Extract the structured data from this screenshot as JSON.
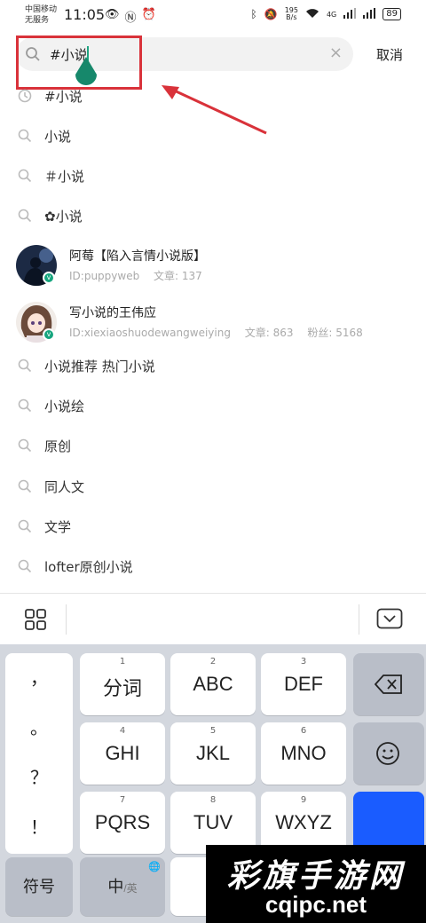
{
  "status_bar": {
    "carrier_line1": "中国移动",
    "carrier_line2": "无服务",
    "time": "11:05",
    "net_speed_value": "195",
    "net_speed_unit": "B/s",
    "network_type": "4G",
    "battery": "89"
  },
  "search": {
    "value": "#小说",
    "cancel_label": "取消"
  },
  "suggestions_top": [
    {
      "label": "#小说",
      "icon": "history-icon"
    },
    {
      "label": "小说",
      "icon": "search-icon"
    },
    {
      "label": "＃小说",
      "icon": "search-icon"
    },
    {
      "label": "✿小说",
      "icon": "search-icon"
    }
  ],
  "users": [
    {
      "name": "阿莓【陷入言情小说版】",
      "id": "ID:puppyweb",
      "articles": "文章: 137",
      "fans": ""
    },
    {
      "name": "写小说的王伟应",
      "id": "ID:xiexiaoshuodewangweiying",
      "articles": "文章: 863",
      "fans": "粉丝: 5168"
    }
  ],
  "suggestions_bottom": [
    {
      "label": "小说推荐 热门小说"
    },
    {
      "label": "小说绘"
    },
    {
      "label": "原创"
    },
    {
      "label": "同人文"
    },
    {
      "label": "文学"
    },
    {
      "label": "lofter原创小说"
    }
  ],
  "keyboard": {
    "punctuation": [
      "，",
      "。",
      "？",
      "！"
    ],
    "keys": [
      {
        "num": "1",
        "label": "分词"
      },
      {
        "num": "2",
        "label": "ABC"
      },
      {
        "num": "3",
        "label": "DEF"
      },
      {
        "num": "4",
        "label": "GHI"
      },
      {
        "num": "5",
        "label": "JKL"
      },
      {
        "num": "6",
        "label": "MNO"
      },
      {
        "num": "7",
        "label": "PQRS"
      },
      {
        "num": "8",
        "label": "TUV"
      },
      {
        "num": "9",
        "label": "WXYZ"
      }
    ],
    "symbols_label": "符号",
    "lang_main": "中",
    "lang_sub": "/英"
  },
  "watermark": {
    "title": "彩旗手游网",
    "url": "cqipc.net"
  },
  "colors": {
    "accent": "#16a57e",
    "annotation": "#d9323a",
    "enter_key": "#1a5cff"
  }
}
